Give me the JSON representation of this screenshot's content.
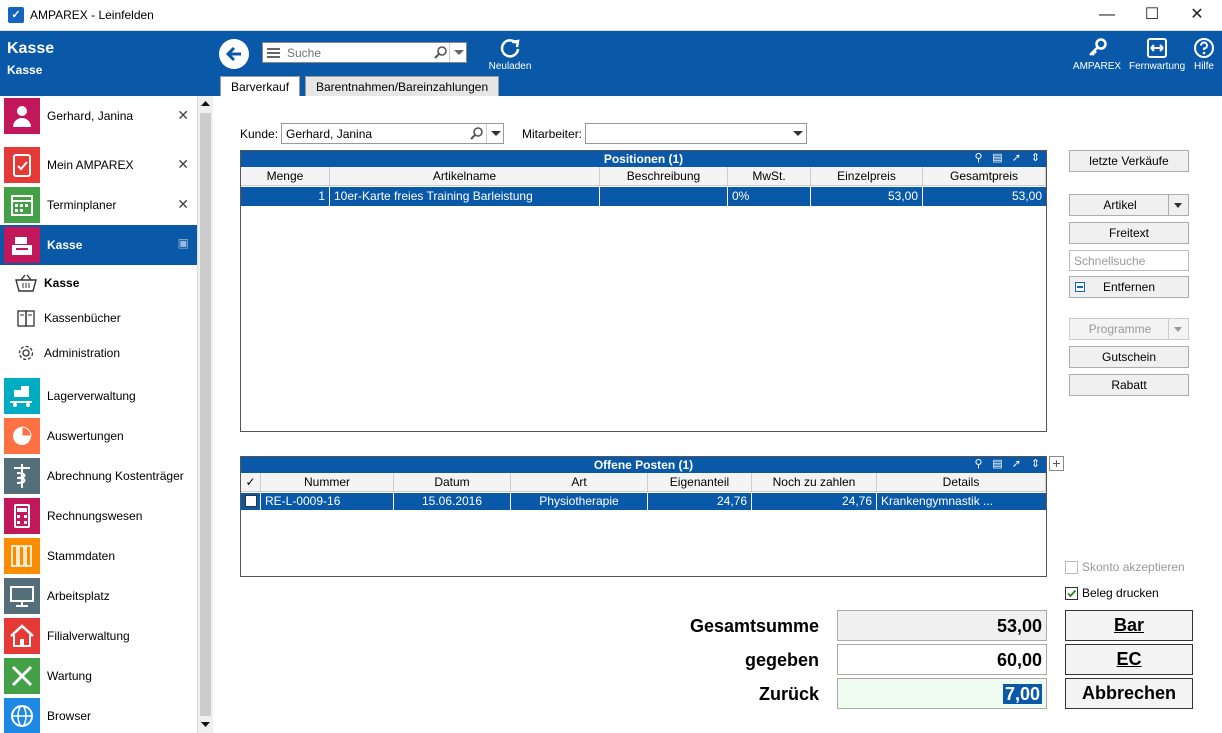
{
  "window": {
    "title": "AMPAREX - Leinfelden"
  },
  "header": {
    "title": "Kasse",
    "subtitle": "Kasse",
    "search_placeholder": "Suche",
    "reload_label": "Neuladen",
    "tools": [
      {
        "label": "AMPAREX"
      },
      {
        "label": "Fernwartung"
      },
      {
        "label": "Hilfe"
      }
    ]
  },
  "tabs": [
    {
      "label": "Barverkauf"
    },
    {
      "label": "Barentnahmen/Bareinzahlungen"
    }
  ],
  "sidebar": {
    "items": [
      {
        "label": "Gerhard, Janina",
        "color": "#c2185b"
      },
      {
        "label": "Mein AMPAREX",
        "color": "#e53935"
      },
      {
        "label": "Terminplaner",
        "color": "#43a047"
      },
      {
        "label": "Kasse",
        "color": "#c2185b"
      },
      {
        "label": "Lagerverwaltung",
        "color": "#00acc1"
      },
      {
        "label": "Auswertungen",
        "color": "#ff7043"
      },
      {
        "label": "Abrechnung Kostenträger",
        "color": "#546e7a"
      },
      {
        "label": "Rechnungswesen",
        "color": "#c2185b"
      },
      {
        "label": "Stammdaten",
        "color": "#fb8c00"
      },
      {
        "label": "Arbeitsplatz",
        "color": "#546e7a"
      },
      {
        "label": "Filialverwaltung",
        "color": "#e53935"
      },
      {
        "label": "Wartung",
        "color": "#43a047"
      },
      {
        "label": "Browser",
        "color": "#1e88e5"
      }
    ],
    "subitems": [
      {
        "label": "Kasse"
      },
      {
        "label": "Kassenbücher"
      },
      {
        "label": "Administration"
      }
    ]
  },
  "form": {
    "kunde_label": "Kunde:",
    "kunde_value": "Gerhard, Janina",
    "mitarbeiter_label": "Mitarbeiter:",
    "mitarbeiter_value": ""
  },
  "positionen": {
    "title": "Positionen (1)",
    "columns": [
      "Menge",
      "Artikelname",
      "Beschreibung",
      "MwSt.",
      "Einzelpreis",
      "Gesamtpreis"
    ],
    "rows": [
      {
        "menge": "1",
        "artikelname": "10er-Karte freies Training Barleistung",
        "beschreibung": "",
        "mwst": "0%",
        "einzelpreis": "53,00",
        "gesamtpreis": "53,00"
      }
    ]
  },
  "offene_posten": {
    "title": "Offene Posten (1)",
    "columns": [
      "Nummer",
      "Datum",
      "Art",
      "Eigenanteil",
      "Noch zu zahlen",
      "Details"
    ],
    "rows": [
      {
        "nummer": "RE-L-0009-16",
        "datum": "15.06.2016",
        "art": "Physiotherapie",
        "eigenanteil": "24,76",
        "noch_zu_zahlen": "24,76",
        "details": "Krankengymnastik ..."
      }
    ]
  },
  "buttons": {
    "letzte_verkaeufe": "letzte Verkäufe",
    "artikel": "Artikel",
    "freitext": "Freitext",
    "schnellsuche_placeholder": "Schnellsuche",
    "entfernen": "Entfernen",
    "programme": "Programme",
    "gutschein": "Gutschein",
    "rabatt": "Rabatt"
  },
  "checkboxes": {
    "skonto": "Skonto akzeptieren",
    "beleg": "Beleg drucken"
  },
  "summary": {
    "gesamtsumme_label": "Gesamtsumme",
    "gesamtsumme_value": "53,00",
    "gegeben_label": "gegeben",
    "gegeben_value": "60,00",
    "zurueck_label": "Zurück",
    "zurueck_value": "7,00"
  },
  "actions": {
    "bar": "Bar",
    "ec": "EC",
    "abbrechen": "Abbrechen"
  }
}
